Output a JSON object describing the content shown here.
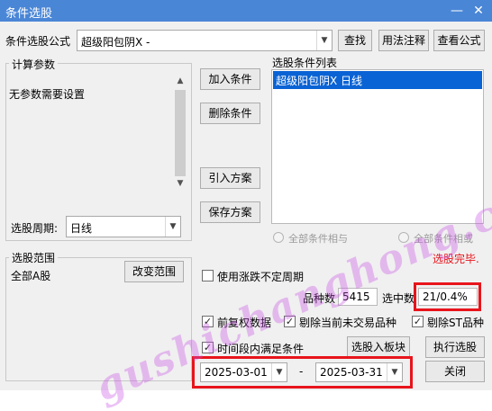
{
  "window": {
    "title": "条件选股",
    "minimize_icon": "minimize-icon",
    "close_icon": "close-icon"
  },
  "formula": {
    "label": "条件选股公式",
    "value": "超级阳包阴X  -",
    "find_button": "查找",
    "usage_button": "用法注释",
    "view_button": "查看公式"
  },
  "params": {
    "legend": "计算参数",
    "text": "无参数需要设置",
    "period_label": "选股周期:",
    "period_value": "日线"
  },
  "conditions": {
    "add_button": "加入条件",
    "delete_button": "删除条件",
    "import_button": "引入方案",
    "save_button": "保存方案",
    "list_label": "选股条件列表",
    "items": [
      "超级阳包阴X  日线"
    ]
  },
  "logic": {
    "and_label": "全部条件相与",
    "or_label": "全部条件相或"
  },
  "status": {
    "text": "选股完毕.",
    "color": "#e8141b"
  },
  "range": {
    "legend": "选股范围",
    "value": "全部A股",
    "change_button": "改变范围"
  },
  "options": {
    "uncertain_period_label": "使用涨跌不定周期",
    "count_label": "品种数",
    "count_value": "5415",
    "selected_label": "选中数",
    "selected_value": "21/0.4%",
    "adjust_label": "前复权数据",
    "exclude_untraded_label": "剔除当前未交易品种",
    "exclude_st_label": "剔除ST品种",
    "period_condition_label": "时间段内满足条件"
  },
  "dates": {
    "start": "2025-03-01",
    "separator": "-",
    "end": "2025-03-31"
  },
  "actions": {
    "to_block_button": "选股入板块",
    "run_button": "执行选股",
    "close_button": "关闭"
  },
  "watermark": {
    "text": "gushichanghong.com"
  },
  "colors": {
    "titlebar": "#4a86d6",
    "selection": "#0a63d4",
    "highlight_box": "#e8141b"
  }
}
